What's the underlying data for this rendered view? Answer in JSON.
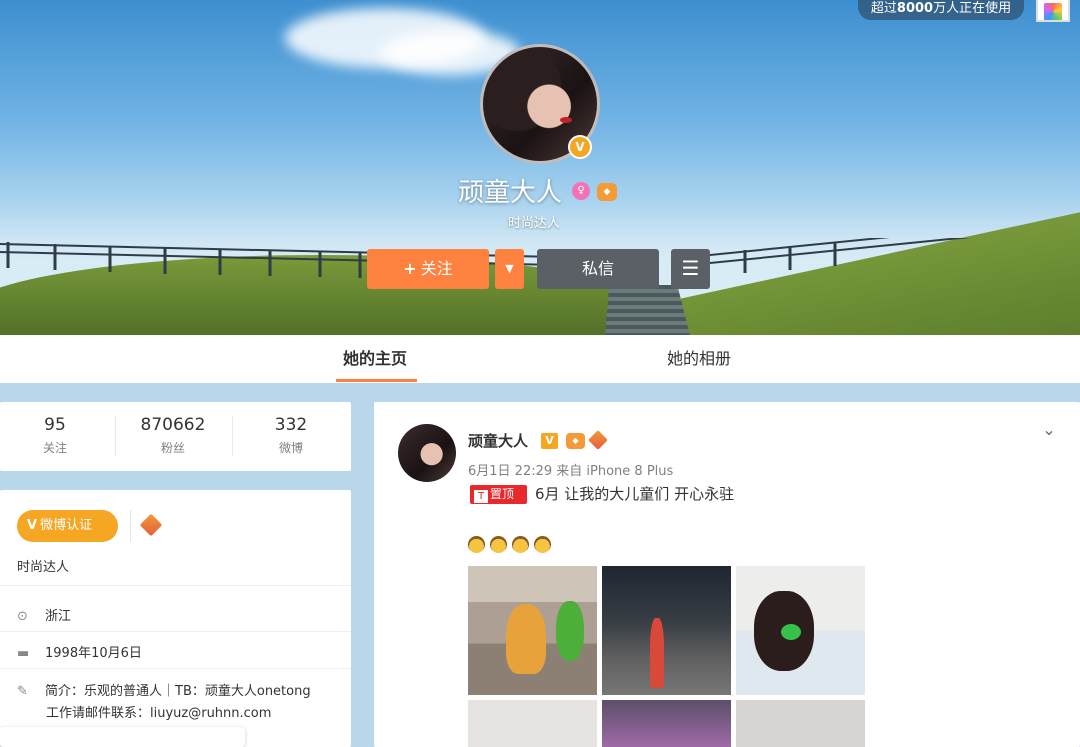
{
  "banner": {
    "badge_prefix": "超过",
    "badge_number": "8000",
    "badge_suffix": "万人正在使用"
  },
  "profile": {
    "nickname": "顽童大人",
    "title": "时尚达人",
    "verified_mark": "V"
  },
  "actions": {
    "follow_plus": "+",
    "follow_label": "关注",
    "dropdown_icon": "▼",
    "message_label": "私信",
    "menu_icon": "☰"
  },
  "tabs": [
    {
      "label": "她的主页",
      "active": true
    },
    {
      "label": "她的相册",
      "active": false
    }
  ],
  "stats": [
    {
      "num": "95",
      "label": "关注"
    },
    {
      "num": "870662",
      "label": "粉丝"
    },
    {
      "num": "332",
      "label": "微博"
    }
  ],
  "info": {
    "verify_icon": "V",
    "verify_label": "微博认证",
    "title": "时尚达人",
    "location_icon": "⊙",
    "location": "浙江",
    "birthday_icon": "▬",
    "birthday": "1998年10月6日",
    "bio_icon": "✎",
    "bio_line1": "简介：乐观的普通人｜TB：顽童大人onetong",
    "bio_line2": "工作请邮件联系：liuyuz@ruhnn.com"
  },
  "post": {
    "author": "顽童大人",
    "verified_mark": "V",
    "meta": "6月1日 22:29 来自 iPhone 8 Plus",
    "pin_icon": "T",
    "pin_label": "置顶",
    "text": "6月 让我的大儿童们 开心永驻",
    "chevron": "⌄"
  },
  "colors": {
    "accent": "#ff8140",
    "verify": "#f5a623",
    "pin": "#e8282b",
    "dark_button": "#5b6066"
  }
}
